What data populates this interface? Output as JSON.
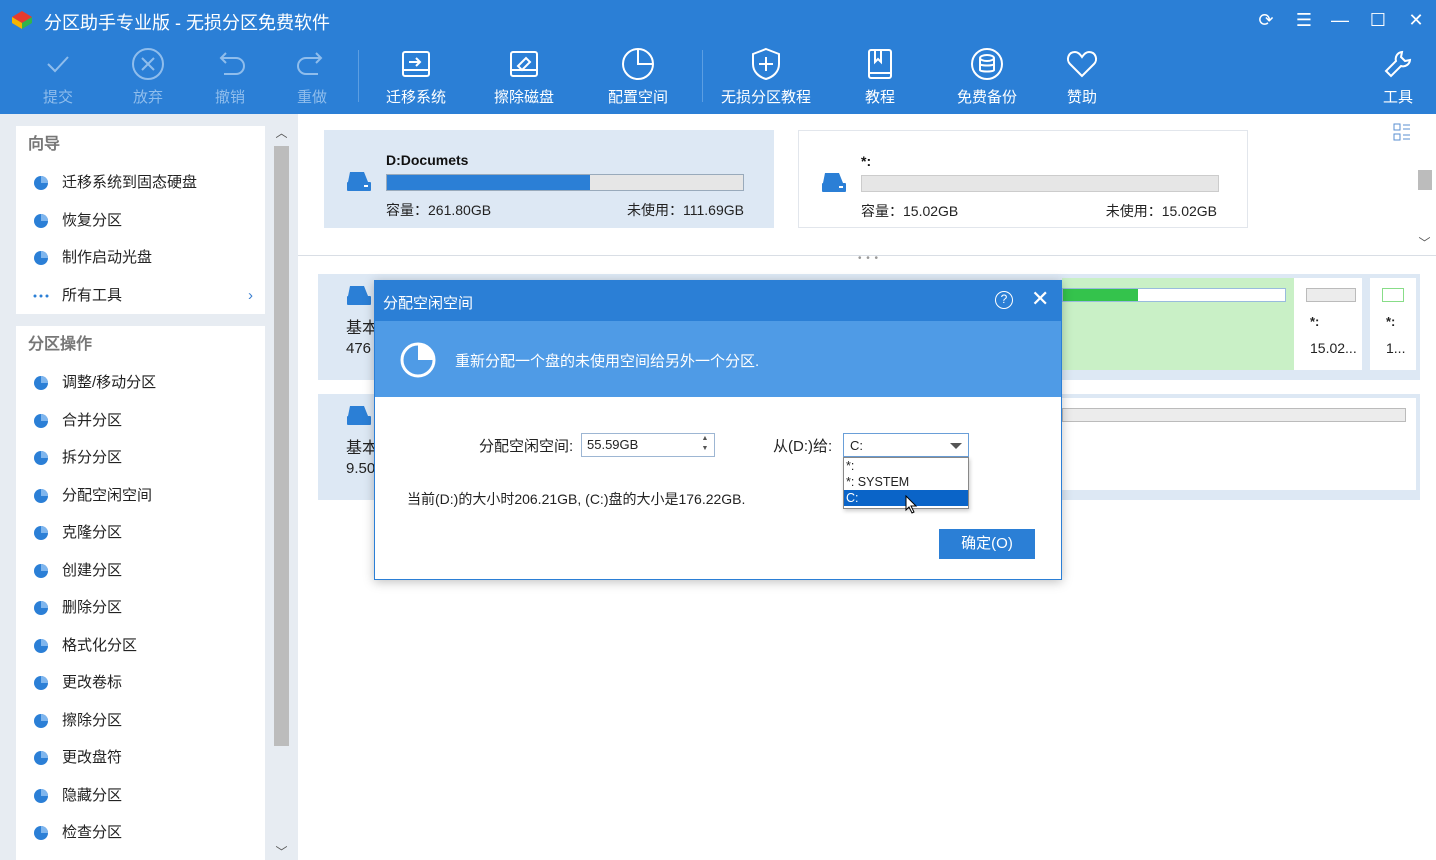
{
  "window": {
    "title": "分区助手专业版 - 无损分区免费软件"
  },
  "toolbar": {
    "commit": "提交",
    "discard": "放弃",
    "undo": "撤销",
    "redo": "重做",
    "migrate_os": "迁移系统",
    "wipe_disk": "擦除磁盘",
    "allocate_space": "配置空间",
    "tutorial_lossless": "无损分区教程",
    "tutorial": "教程",
    "free_backup": "免费备份",
    "donate": "赞助",
    "tools": "工具"
  },
  "sidebar": {
    "wizard_title": "向导",
    "wizard_items": [
      {
        "label": "迁移系统到固态硬盘",
        "icon": "migrate-ssd-icon"
      },
      {
        "label": "恢复分区",
        "icon": "recover-partition-icon"
      },
      {
        "label": "制作启动光盘",
        "icon": "bootable-media-icon"
      },
      {
        "label": "所有工具",
        "icon": "more-icon"
      }
    ],
    "ops_title": "分区操作",
    "ops_items": [
      {
        "label": "调整/移动分区",
        "icon": "resize-partition-icon"
      },
      {
        "label": "合并分区",
        "icon": "merge-partition-icon"
      },
      {
        "label": "拆分分区",
        "icon": "split-partition-icon"
      },
      {
        "label": "分配空闲空间",
        "icon": "allocate-space-icon"
      },
      {
        "label": "克隆分区",
        "icon": "clone-partition-icon"
      },
      {
        "label": "创建分区",
        "icon": "create-partition-icon"
      },
      {
        "label": "删除分区",
        "icon": "delete-partition-icon"
      },
      {
        "label": "格式化分区",
        "icon": "format-partition-icon"
      },
      {
        "label": "更改卷标",
        "icon": "label-icon"
      },
      {
        "label": "擦除分区",
        "icon": "wipe-partition-icon"
      },
      {
        "label": "更改盘符",
        "icon": "drive-letter-icon"
      },
      {
        "label": "隐藏分区",
        "icon": "hide-partition-icon"
      },
      {
        "label": "检查分区",
        "icon": "check-partition-icon"
      }
    ]
  },
  "top_cards": [
    {
      "name": "D:Documets",
      "capacity": "容量：261.80GB",
      "free": "未使用：111.69GB",
      "used_fraction": 0.57
    },
    {
      "name": "*:",
      "capacity": "容量：15.02GB",
      "free": "未使用：15.02GB",
      "used_fraction": 0.0
    }
  ],
  "disks": [
    {
      "name": "基本",
      "size": "476",
      "partitions": [
        {
          "label": "*:",
          "size": "15.02..."
        },
        {
          "label": "*:",
          "size": "1..."
        }
      ]
    },
    {
      "name": "基本",
      "size": "9.50"
    }
  ],
  "dialog": {
    "title": "分配空闲空间",
    "help": "?",
    "close": "✕",
    "banner": "重新分配一个盘的未使用空间给另外一个分区.",
    "space_label": "分配空闲空间:",
    "space_value": "55.59GB",
    "from_label": "从(D:)给:",
    "combo_value": "C:",
    "options": [
      "*:",
      "*: SYSTEM",
      "C:"
    ],
    "selected_option": "C:",
    "info": "当前(D:)的大小时206.21GB, (C:)盘的大小是176.22GB.",
    "ok": "确定(O)"
  }
}
